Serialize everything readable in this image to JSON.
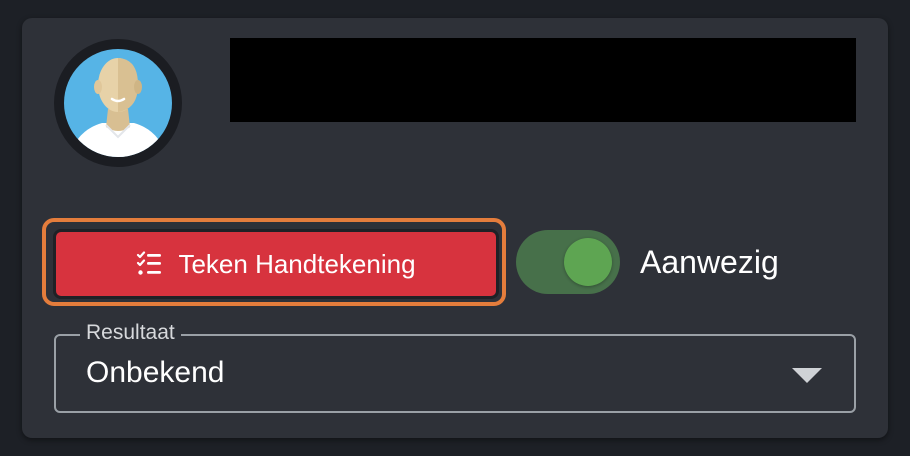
{
  "sign_button": {
    "label": "Teken Handtekening",
    "icon": "checklist-icon"
  },
  "presence_toggle": {
    "label": "Aanwezig",
    "checked": true
  },
  "result_select": {
    "label": "Resultaat",
    "value": "Onbekend"
  },
  "avatar": {
    "icon": "person-avatar"
  },
  "colors": {
    "page_bg": "#1d2026",
    "card_bg": "#2e3138",
    "button_red": "#d7333e",
    "focus_orange": "#e47d3c",
    "toggle_track": "#47704a",
    "toggle_thumb": "#5ea552",
    "avatar_blue": "#56b4e6"
  }
}
